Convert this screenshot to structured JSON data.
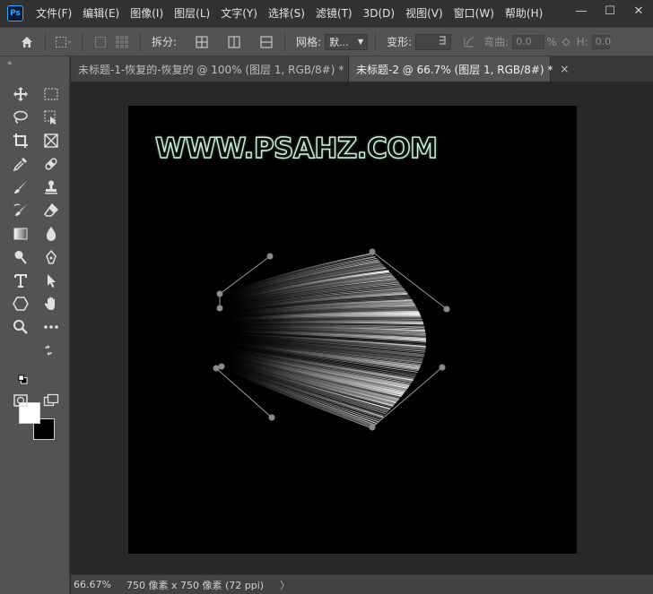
{
  "app": {
    "logo": "Ps"
  },
  "menu": [
    "文件(F)",
    "编辑(E)",
    "图像(I)",
    "图层(L)",
    "文字(Y)",
    "选择(S)",
    "滤镜(T)",
    "3D(D)",
    "视图(V)",
    "窗口(W)",
    "帮助(H)"
  ],
  "window_controls": {
    "minimize": "—",
    "maximize": "☐",
    "close": "✕"
  },
  "options_bar": {
    "split_label": "拆分:",
    "grid_label": "网格:",
    "grid_value": "默...",
    "warp_label": "变形:",
    "bend_label": "弯曲:",
    "bend_value": "0.0",
    "bend_unit": "%",
    "h_label": "H:",
    "h_value": "0.0"
  },
  "tabs": [
    {
      "label": "未标题-1-恢复的-恢复的 @ 100% (图层 1, RGB/8#) *",
      "close": "×",
      "active": false
    },
    {
      "label": "未标题-2 @ 66.7% (图层 1, RGB/8#) *",
      "close": "×",
      "active": true
    }
  ],
  "canvas": {
    "watermark": "WWW.PSAHZ.COM"
  },
  "status": {
    "zoom": "66.67%",
    "doc_info": "750 像素 x 750 像素 (72 ppi)",
    "arrow": "〉"
  },
  "colors": {
    "foreground": "#ffffff",
    "background": "#000000",
    "accent": "#31a8ff"
  },
  "icons": {
    "options": [
      "home-icon",
      "transform-select-icon",
      "warp-split-icons",
      "grid-option-icons",
      "warp-mode-icon"
    ],
    "tools": [
      "move-icon",
      "marquee-icon",
      "lasso-icon",
      "object-select-icon",
      "crop-icon",
      "frame-icon",
      "eyedropper-icon",
      "healing-brush-icon",
      "brush-icon",
      "stamp-icon",
      "history-brush-icon",
      "eraser-icon",
      "gradient-icon",
      "blur-icon",
      "dodge-icon",
      "pen-icon",
      "type-icon",
      "path-select-icon",
      "shape-icon",
      "hand-icon",
      "zoom-icon",
      "more-tools-icon",
      "quick-mask-icon",
      "screen-mode-icon"
    ]
  }
}
